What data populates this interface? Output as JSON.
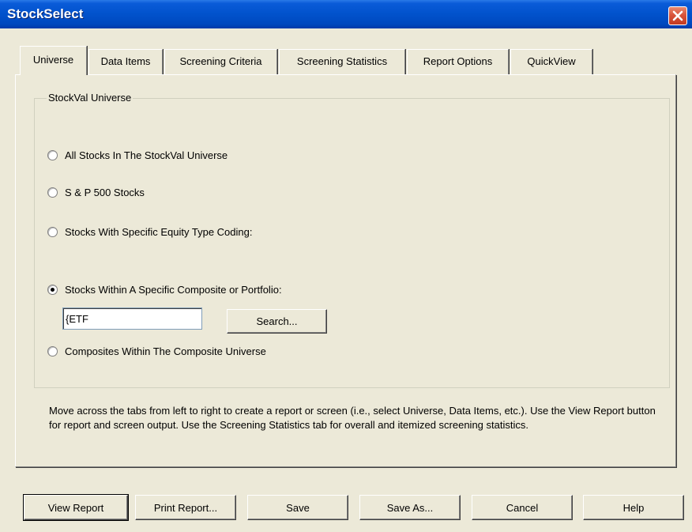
{
  "window": {
    "title": "StockSelect",
    "close_icon": "close-icon"
  },
  "tabs": [
    {
      "label": "Universe",
      "active": true
    },
    {
      "label": "Data Items"
    },
    {
      "label": "Screening Criteria"
    },
    {
      "label": "Screening Statistics"
    },
    {
      "label": "Report Options"
    },
    {
      "label": "QuickView"
    }
  ],
  "universe": {
    "group_label": "StockVal Universe",
    "options": [
      {
        "label": "All Stocks In The StockVal Universe",
        "checked": false
      },
      {
        "label": "S & P 500 Stocks",
        "checked": false
      },
      {
        "label": "Stocks With Specific Equity Type Coding:",
        "checked": false
      },
      {
        "label": "Stocks Within A Specific Composite or Portfolio:",
        "checked": true
      },
      {
        "label": "Composites Within The Composite Universe",
        "checked": false
      }
    ],
    "composite_input_value": "{ETF",
    "search_button": "Search..."
  },
  "help_text": "Move across the tabs from left to right to create a report or screen (i.e., select Universe, Data Items, etc.). Use the View Report button for report and screen output.  Use the Screening Statistics tab for overall and itemized screening statistics.",
  "buttons": {
    "view_report": "View Report",
    "print_report": "Print Report...",
    "save": "Save",
    "save_as": "Save As...",
    "cancel": "Cancel",
    "help": "Help"
  },
  "colors": {
    "titlebar": "#0152cc",
    "window_bg": "#ece9d8",
    "close_button": "#d9543b"
  }
}
